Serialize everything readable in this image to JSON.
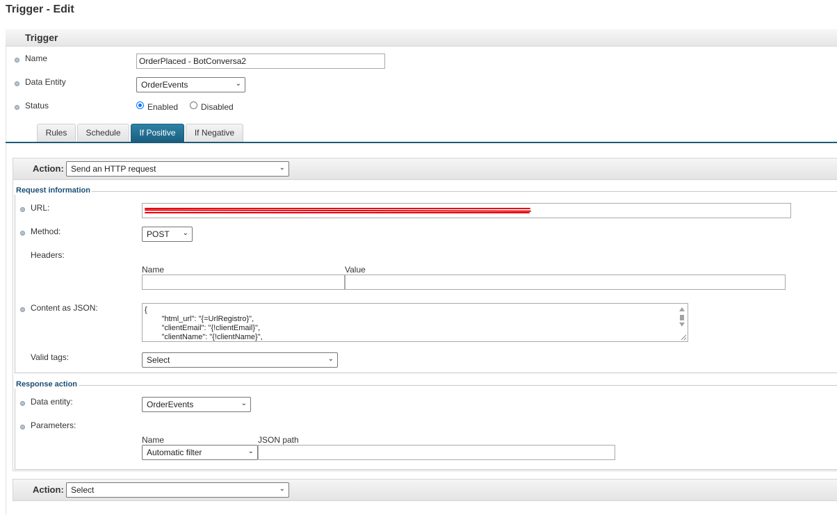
{
  "page": {
    "title": "Trigger - Edit"
  },
  "trigger": {
    "header": "Trigger",
    "name_label": "Name",
    "name_value": "OrderPlaced - BotConversa2",
    "data_entity_label": "Data Entity",
    "data_entity_value": "OrderEvents",
    "status_label": "Status",
    "status_options": [
      "Enabled",
      "Disabled"
    ],
    "status_selected": "Enabled"
  },
  "tabs": [
    {
      "label": "Rules",
      "active": false
    },
    {
      "label": "Schedule",
      "active": false
    },
    {
      "label": "If Positive",
      "active": true
    },
    {
      "label": "If Negative",
      "active": false
    }
  ],
  "action1": {
    "label": "Action:",
    "value": "Send an HTTP request",
    "request": {
      "legend": "Request information",
      "url_label": "URL:",
      "url_value_redacted": true,
      "method_label": "Method:",
      "method_value": "POST",
      "headers_label": "Headers:",
      "headers_name_col": "Name",
      "headers_value_col": "Value",
      "content_label": "Content as JSON:",
      "content_lines": [
        "{",
        "        \"html_url\": \"{=UrlRegistro}\",",
        "        \"clientEmail\": \"{!clientEmail}\",",
        "        \"clientName\": \"{!clientName}\","
      ],
      "valid_tags_label": "Valid tags:",
      "valid_tags_value": "Select"
    },
    "response": {
      "legend": "Response action",
      "data_entity_label": "Data entity:",
      "data_entity_value": "OrderEvents",
      "parameters_label": "Parameters:",
      "name_col": "Name",
      "json_path_col": "JSON path",
      "name_value": "Automatic filter",
      "json_path_value": ""
    }
  },
  "action2": {
    "label": "Action:",
    "value": "Select"
  },
  "colors": {
    "accent": "#1c5a78",
    "legend": "#1b4e73",
    "radio": "#0075ff",
    "redaction": "#e8000b"
  }
}
